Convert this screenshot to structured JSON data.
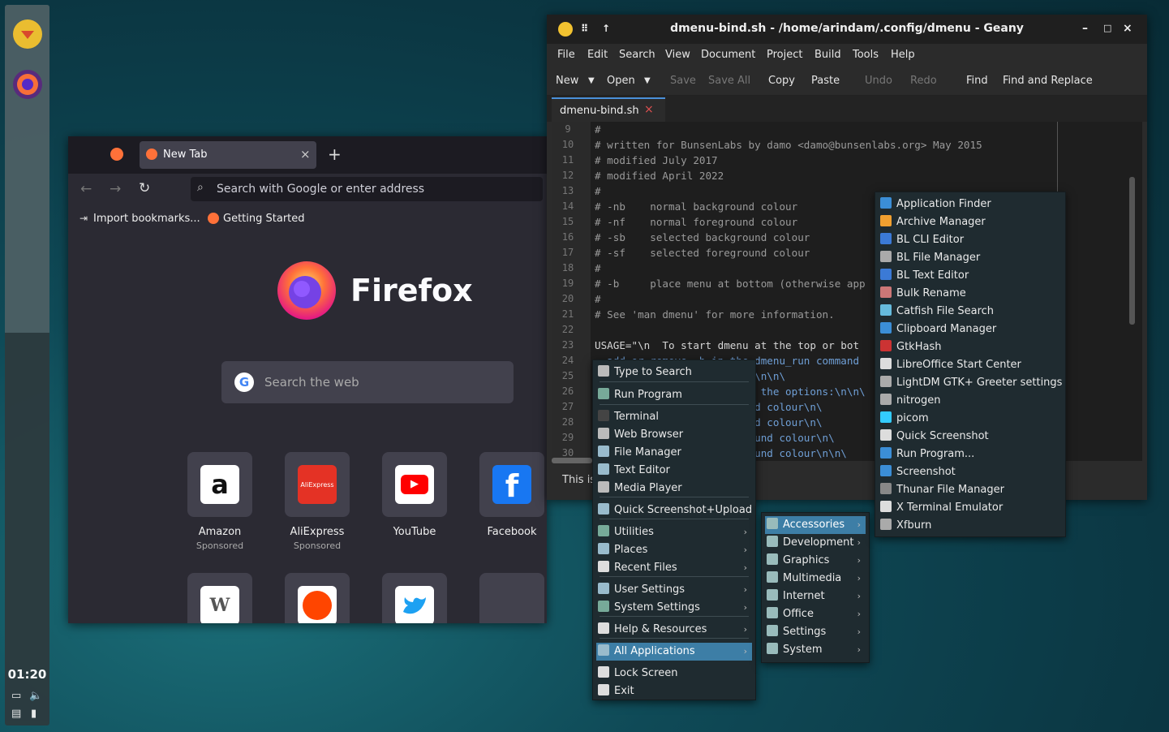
{
  "panel": {
    "clock": "01:20"
  },
  "firefox": {
    "tab_title": "New Tab",
    "tab_close": "×",
    "new_tab": "+",
    "search_placeholder": "Search with Google or enter address",
    "bookmarks": [
      "Import bookmarks...",
      "Getting Started"
    ],
    "brand": "Firefox",
    "web_search_placeholder": "Search the web",
    "tiles": [
      {
        "name": "Amazon",
        "sub": "Sponsored",
        "glyph": "a",
        "bg": "#ffffff",
        "fg": "#111111"
      },
      {
        "name": "AliExpress",
        "sub": "Sponsored",
        "glyph": "AliExpress",
        "bg": "#e43225",
        "fg": "#ffffff"
      },
      {
        "name": "YouTube",
        "sub": "",
        "glyph": "▶",
        "bg": "#ffffff",
        "fg": "#ff0000"
      },
      {
        "name": "Facebook",
        "sub": "",
        "glyph": "f",
        "bg": "#1877f2",
        "fg": "#ffffff"
      }
    ]
  },
  "geany": {
    "title": "dmenu-bind.sh - /home/arindam/.config/dmenu - Geany",
    "menu": [
      "File",
      "Edit",
      "Search",
      "View",
      "Document",
      "Project",
      "Build",
      "Tools",
      "Help"
    ],
    "toolbar": {
      "new": "New",
      "open": "Open",
      "save": "Save",
      "save_all": "Save All",
      "copy": "Copy",
      "paste": "Paste",
      "undo": "Undo",
      "redo": "Redo",
      "find": "Find",
      "find_replace": "Find and Replace"
    },
    "tab": "dmenu-bind.sh",
    "tab_close": "×",
    "status": "This is",
    "lines": [
      {
        "n": "9",
        "t": "#",
        "k": "c"
      },
      {
        "n": "10",
        "t": "# written for BunsenLabs by damo <damo@bunsenlabs.org> May 2015",
        "k": "c"
      },
      {
        "n": "11",
        "t": "# modified July 2017",
        "k": "c"
      },
      {
        "n": "12",
        "t": "# modified April 2022",
        "k": "c"
      },
      {
        "n": "13",
        "t": "#",
        "k": "c"
      },
      {
        "n": "14",
        "t": "# -nb    normal background colour",
        "k": "c"
      },
      {
        "n": "15",
        "t": "# -nf    normal foreground colour",
        "k": "c"
      },
      {
        "n": "16",
        "t": "# -sb    selected background colour",
        "k": "c"
      },
      {
        "n": "17",
        "t": "# -sf    selected foreground colour",
        "k": "c"
      },
      {
        "n": "18",
        "t": "#",
        "k": "c"
      },
      {
        "n": "19",
        "t": "# -b     place menu at bottom (otherwise app",
        "k": "c"
      },
      {
        "n": "20",
        "t": "#",
        "k": "c"
      },
      {
        "n": "21",
        "t": "# See 'man dmenu' for more information.",
        "k": "c"
      },
      {
        "n": "22",
        "t": "",
        "k": "c"
      },
      {
        "n": "23",
        "t": "USAGE=\"\\n  To start dmenu at the top or bot",
        "k": "v"
      },
      {
        "n": "24",
        "t": "  add or remove -b in the dmenu_run command",
        "k": "s"
      },
      {
        "n": "25",
        "t": "                          \\n\\n\\",
        "k": "s"
      },
      {
        "n": "26",
        "t": "                           the options:\\n\\n\\",
        "k": "s"
      },
      {
        "n": "27",
        "t": "                          d colour\\n\\",
        "k": "s"
      },
      {
        "n": "28",
        "t": "                          d colour\\n\\",
        "k": "s"
      },
      {
        "n": "29",
        "t": "                          und colour\\n\\",
        "k": "s"
      },
      {
        "n": "30",
        "t": "                          und colour\\n\\n\\",
        "k": "s"
      }
    ]
  },
  "main_menu": [
    {
      "label": "Type to Search",
      "icon": "search-icon"
    },
    {
      "label": "Run Program",
      "icon": "gear-icon"
    },
    {
      "label": "Terminal",
      "icon": "terminal-icon"
    },
    {
      "label": "Web Browser",
      "icon": "globe-icon"
    },
    {
      "label": "File Manager",
      "icon": "folder-icon"
    },
    {
      "label": "Text Editor",
      "icon": "edit-icon"
    },
    {
      "label": "Media Player",
      "icon": "media-icon"
    },
    {
      "label": "Quick Screenshot+Upload",
      "icon": "camera-icon"
    },
    {
      "label": "Utilities",
      "icon": "gear-icon",
      "arrow": "›"
    },
    {
      "label": "Places",
      "icon": "folder-icon",
      "arrow": "›"
    },
    {
      "label": "Recent Files",
      "icon": "clock-icon",
      "arrow": "›"
    },
    {
      "label": "User Settings",
      "icon": "settings-icon",
      "arrow": "›"
    },
    {
      "label": "System Settings",
      "icon": "gear-icon",
      "arrow": "›"
    },
    {
      "label": "Help & Resources",
      "icon": "help-icon",
      "arrow": "›"
    },
    {
      "label": "All Applications",
      "icon": "apps-icon",
      "arrow": "›",
      "selected": true
    },
    {
      "label": "Lock Screen",
      "icon": "lock-icon"
    },
    {
      "label": "Exit",
      "icon": "power-icon"
    }
  ],
  "categories_menu": [
    {
      "label": "Accessories",
      "selected": true
    },
    {
      "label": "Development"
    },
    {
      "label": "Graphics"
    },
    {
      "label": "Multimedia"
    },
    {
      "label": "Internet"
    },
    {
      "label": "Office"
    },
    {
      "label": "Settings"
    },
    {
      "label": "System"
    }
  ],
  "apps_menu": [
    "Application Finder",
    "Archive Manager",
    "BL CLI Editor",
    "BL File Manager",
    "BL Text Editor",
    "Bulk Rename",
    "Catfish File Search",
    "Clipboard Manager",
    "GtkHash",
    "LibreOffice Start Center",
    "LightDM GTK+ Greeter settings",
    "nitrogen",
    "picom",
    "Quick Screenshot",
    "Run Program...",
    "Screenshot",
    "Thunar File Manager",
    "X Terminal Emulator",
    "Xfburn"
  ],
  "colors": {
    "accent": "#3d7ea6",
    "menu_bg": "#1f2b30",
    "firefox_bg": "#2b2a33"
  }
}
